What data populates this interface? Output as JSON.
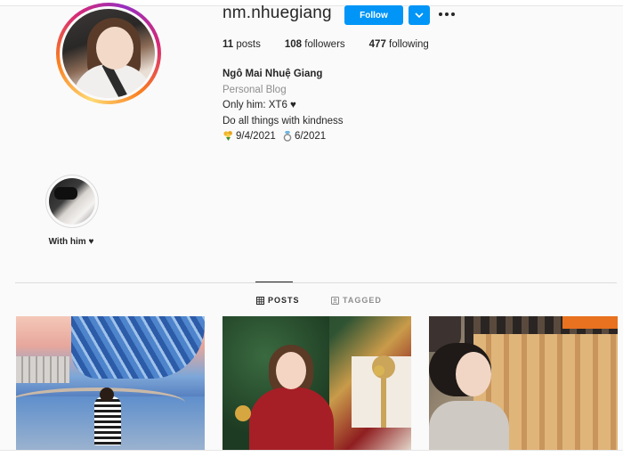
{
  "profile": {
    "username": "nm.nhuegiang",
    "follow_label": "Follow",
    "stats": {
      "posts_count": "11",
      "posts_label": "posts",
      "followers_count": "108",
      "followers_label": "followers",
      "following_count": "477",
      "following_label": "following"
    },
    "bio": {
      "full_name": "Ngô Mai Nhuệ Giang",
      "category": "Personal Blog",
      "line1": "Only him: XT6 ♥",
      "line2": "Do all things with kindness",
      "date1": "9/4/2021",
      "date2": "6/2021",
      "date1_icon": "bouquet-icon",
      "date2_icon": "ring-icon"
    }
  },
  "highlights": [
    {
      "label": "With him ♥"
    }
  ],
  "tabs": [
    {
      "label": "POSTS",
      "icon": "grid-icon",
      "active": true
    },
    {
      "label": "TAGGED",
      "icon": "tag-icon",
      "active": false
    }
  ],
  "posts": [
    {
      "index": 1
    },
    {
      "index": 2
    },
    {
      "index": 3
    }
  ],
  "colors": {
    "accent": "#0095f6",
    "text": "#262626",
    "muted": "#8e8e8e",
    "background": "#fafafa"
  }
}
